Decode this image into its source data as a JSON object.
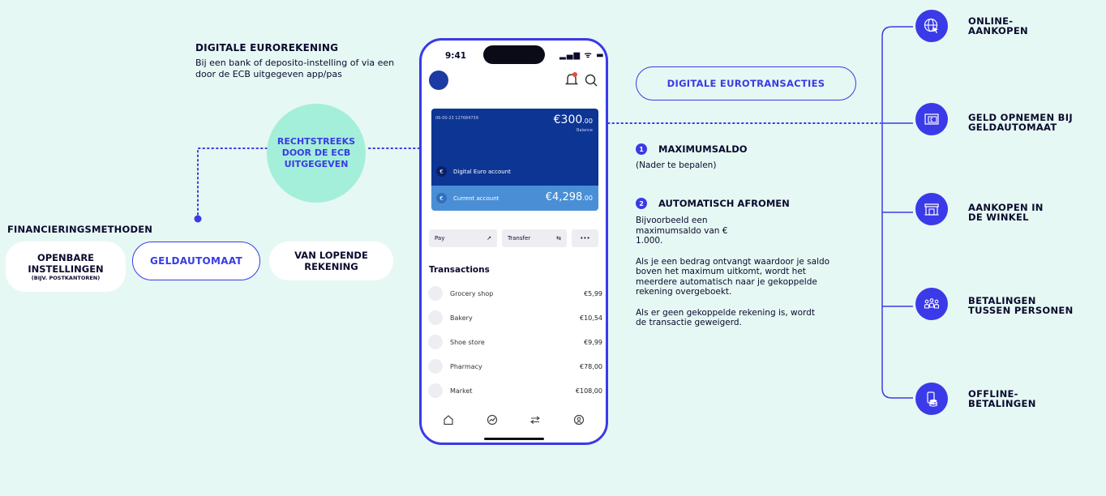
{
  "digitale_eurorekening": {
    "title": "DIGITALE EUROREKENING",
    "description": "Bij een bank of deposito-instelling of via een door de ECB uitgegeven app/pas"
  },
  "ecb_circle": "RECHTSTREEKS DOOR DE ECB UITGEGEVEN",
  "financieringsmethoden": {
    "title": "FINANCIERINGSMETHODEN",
    "openbare_line1": "OPENBARE",
    "openbare_line2": "INSTELLINGEN",
    "openbare_note": "(BIJV. POSTKANTOREN)",
    "geldautomaat": "GELDAUTOMAAT",
    "lopende_rekening": "VAN LOPENDE REKENING"
  },
  "phone": {
    "time": "9:41",
    "status_icons": "▂▄▆ ᯤ ▬",
    "card": {
      "account_number": "06-00-23  127684739",
      "balance_main": "€300",
      "balance_cents": ".00",
      "balance_label": "Balance",
      "digital_account_label": "Digital Euro account",
      "current_account_label": "Current account",
      "current_balance_main": "€4,298",
      "current_balance_cents": ".00",
      "euro_symbol": "€"
    },
    "actions": [
      {
        "label": "Pay",
        "glyph": "↗"
      },
      {
        "label": "Transfer",
        "glyph": "⇆"
      },
      {
        "label": "",
        "glyph": "•••"
      }
    ],
    "transactions_title": "Transactions",
    "transactions": [
      {
        "name": "Grocery shop",
        "amount": "€5,99"
      },
      {
        "name": "Bakery",
        "amount": "€10,54"
      },
      {
        "name": "Shoe store",
        "amount": "€9,99"
      },
      {
        "name": "Pharmacy",
        "amount": "€78,00"
      },
      {
        "name": "Market",
        "amount": "€108,00"
      }
    ],
    "nav_icons": [
      "home-icon",
      "chart-icon",
      "transfer-icon",
      "profile-icon"
    ]
  },
  "transacties": {
    "pill": "DIGITALE EUROTRANSACTIES",
    "max_num": "1",
    "max_title": "MAXIMUMSALDO",
    "max_desc": "(Nader te bepalen)",
    "auto_num": "2",
    "auto_title": "AUTOMATISCH AFROMEN",
    "auto_p1": "Bijvoorbeeld een maximumsaldo van € 1.000.",
    "auto_p2": "Als je een bedrag ontvangt waardoor je saldo boven het maximum uitkomt, wordt het meerdere automatisch naar je gekoppelde rekening overgeboekt.",
    "auto_p3": "Als er geen gekoppelde rekening is, wordt de transactie geweigerd."
  },
  "use_cases": [
    {
      "line1": "ONLINE-",
      "line2": "AANKOPEN",
      "icon": "globe-cursor-icon"
    },
    {
      "line1": "GELD OPNEMEN BIJ",
      "line2": "GELDAUTOMAAT",
      "icon": "atm-icon"
    },
    {
      "line1": "AANKOPEN IN",
      "line2": "DE WINKEL",
      "icon": "store-icon"
    },
    {
      "line1": "BETALINGEN",
      "line2": "TUSSEN PERSONEN",
      "icon": "people-icon"
    },
    {
      "line1": "OFFLINE-",
      "line2": "BETALINGEN",
      "icon": "coins-phone-icon"
    }
  ],
  "colors": {
    "background": "#e6f8f3",
    "accent": "#3a3ae8",
    "mint": "#a4efd9",
    "card_dark": "#0d3594",
    "card_light": "#4a8fd6"
  }
}
